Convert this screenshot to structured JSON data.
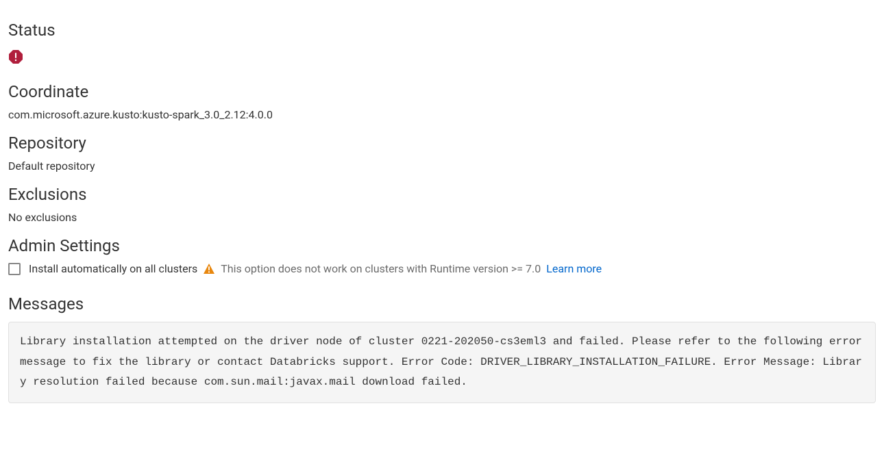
{
  "status": {
    "heading": "Status",
    "icon": "error-octagon-icon",
    "icon_color": "#b01e3c"
  },
  "coordinate": {
    "heading": "Coordinate",
    "value": "com.microsoft.azure.kusto:kusto-spark_3.0_2.12:4.0.0"
  },
  "repository": {
    "heading": "Repository",
    "value": "Default repository"
  },
  "exclusions": {
    "heading": "Exclusions",
    "value": "No exclusions"
  },
  "admin_settings": {
    "heading": "Admin Settings",
    "checkbox_label": "Install automatically on all clusters",
    "checkbox_checked": false,
    "warning_icon_color": "#e8870e",
    "help_text": "This option does not work on clusters with Runtime version >= 7.0",
    "learn_more_label": "Learn more"
  },
  "messages": {
    "heading": "Messages",
    "body": "Library installation attempted on the driver node of cluster 0221-202050-cs3eml3 and failed. Please refer to the following error message to fix the library or contact Databricks support. Error Code: DRIVER_LIBRARY_INSTALLATION_FAILURE. Error Message: Library resolution failed because com.sun.mail:javax.mail download failed."
  }
}
